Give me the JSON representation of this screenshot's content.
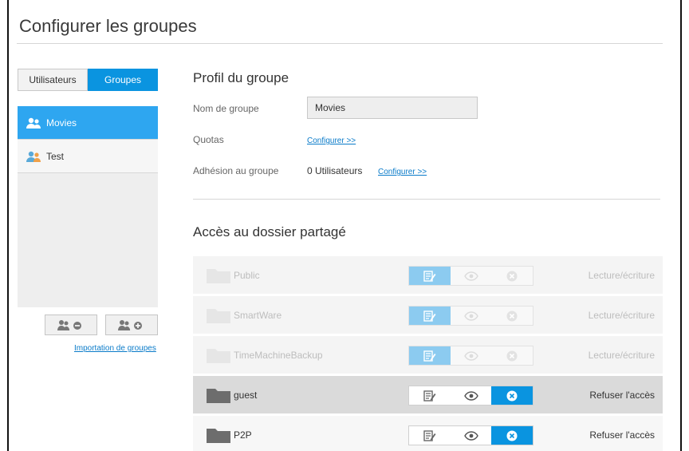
{
  "page": {
    "title": "Configurer les groupes"
  },
  "sidebar": {
    "tabs": [
      {
        "label": "Utilisateurs",
        "active": false
      },
      {
        "label": "Groupes",
        "active": true
      }
    ],
    "groups": [
      {
        "label": "Movies",
        "selected": true
      },
      {
        "label": "Test",
        "selected": false
      }
    ],
    "remove_group_icon": "group-remove-icon",
    "add_group_icon": "group-add-icon",
    "import_link": "Importation de groupes"
  },
  "profile": {
    "heading": "Profil du groupe",
    "name_label": "Nom de groupe",
    "name_value": "Movies",
    "quotas_label": "Quotas",
    "quotas_link": "Configurer >>",
    "membership_label": "Adhésion au groupe",
    "membership_value": "0 Utilisateurs",
    "membership_link": "Configurer >>"
  },
  "shares": {
    "heading": "Accès au dossier partagé",
    "accent_color": "#0a94e0",
    "rows": [
      {
        "name": "Public",
        "status": "Lecture/écriture",
        "access": "read-write",
        "enabled": false
      },
      {
        "name": "SmartWare",
        "status": "Lecture/écriture",
        "access": "read-write",
        "enabled": false
      },
      {
        "name": "TimeMachineBackup",
        "status": "Lecture/écriture",
        "access": "read-write",
        "enabled": false
      },
      {
        "name": "guest",
        "status": "Refuser l'accès",
        "access": "deny",
        "enabled": true
      },
      {
        "name": "P2P",
        "status": "Refuser l'accès",
        "access": "deny",
        "enabled": true
      }
    ]
  }
}
